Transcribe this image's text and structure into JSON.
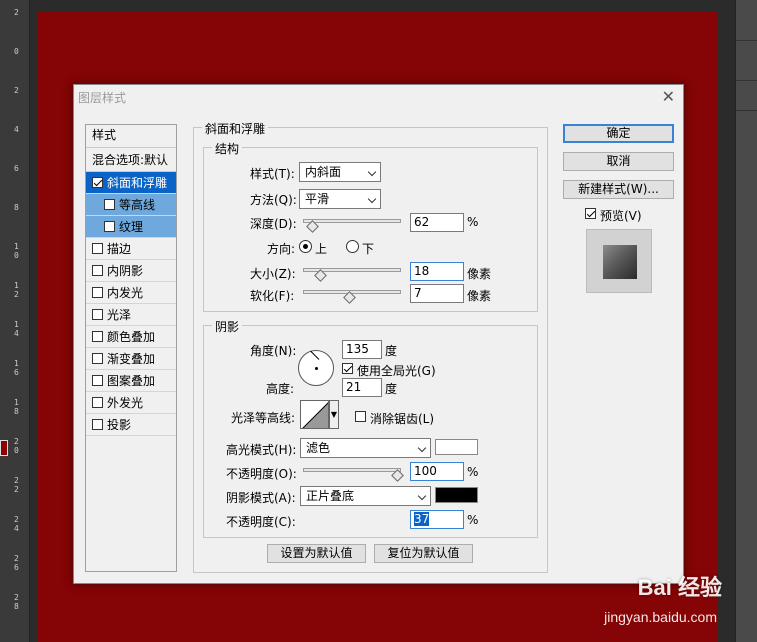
{
  "ruler": {
    "ticks": [
      "2",
      "0",
      "2",
      "4",
      "6",
      "8",
      "1 0",
      "1 2",
      "1 4",
      "1 6",
      "1 8",
      "2 0",
      "2 2",
      "2 4",
      "2 6",
      "2 8"
    ]
  },
  "dialog": {
    "title": "图层样式",
    "close": "✕"
  },
  "styles_list": {
    "header": "样式",
    "blending": "混合选项:默认",
    "items": [
      {
        "label": "斜面和浮雕",
        "checked": true
      },
      {
        "label": "等高线",
        "checked": false
      },
      {
        "label": "纹理",
        "checked": false
      },
      {
        "label": "描边",
        "checked": false
      },
      {
        "label": "内阴影",
        "checked": false
      },
      {
        "label": "内发光",
        "checked": false
      },
      {
        "label": "光泽",
        "checked": false
      },
      {
        "label": "颜色叠加",
        "checked": false
      },
      {
        "label": "渐变叠加",
        "checked": false
      },
      {
        "label": "图案叠加",
        "checked": false
      },
      {
        "label": "外发光",
        "checked": false
      },
      {
        "label": "投影",
        "checked": false
      }
    ]
  },
  "bevel": {
    "section_title": "斜面和浮雕",
    "structure_title": "结构",
    "style_label": "样式(T):",
    "style_value": "内斜面",
    "method_label": "方法(Q):",
    "method_value": "平滑",
    "depth_label": "深度(D):",
    "depth_value": "62",
    "percent": "%",
    "depth_level": 0.06,
    "direction_label": "方向:",
    "dir_up": "上",
    "dir_down": "下",
    "size_label": "大小(Z):",
    "size_value": "18",
    "px_unit": "像素",
    "size_level": 0.14,
    "soften_label": "软化(F):",
    "soften_value": "7",
    "soften_level": 0.47
  },
  "shading": {
    "title": "阴影",
    "angle_label": "角度(N):",
    "angle_value": "135",
    "deg": "度",
    "global_light": "使用全局光(G)",
    "altitude_label": "高度:",
    "altitude_value": "21",
    "gloss_label": "光泽等高线:",
    "antialias": "消除锯齿(L)",
    "highlight_mode_label": "高光模式(H):",
    "highlight_mode_value": "滤色",
    "highlight_color": "#ffffff",
    "opacity1_label": "不透明度(O):",
    "opacity1_value": "100",
    "opacity1_level": 1.0,
    "shadow_mode_label": "阴影模式(A):",
    "shadow_mode_value": "正片叠底",
    "shadow_color": "#000000",
    "opacity2_label": "不透明度(C):",
    "opacity2_value": "37"
  },
  "bottom_buttons": {
    "set_default": "设置为默认值",
    "reset_default": "复位为默认值"
  },
  "right_buttons": {
    "ok": "确定",
    "cancel": "取消",
    "new_style": "新建样式(W)...",
    "preview": "预览(V)"
  },
  "watermark": {
    "brand": "Bai 经验",
    "url": "jingyan.baidu.com"
  },
  "colors": {
    "canvas": "#850405",
    "accent": "#0a64c8"
  }
}
